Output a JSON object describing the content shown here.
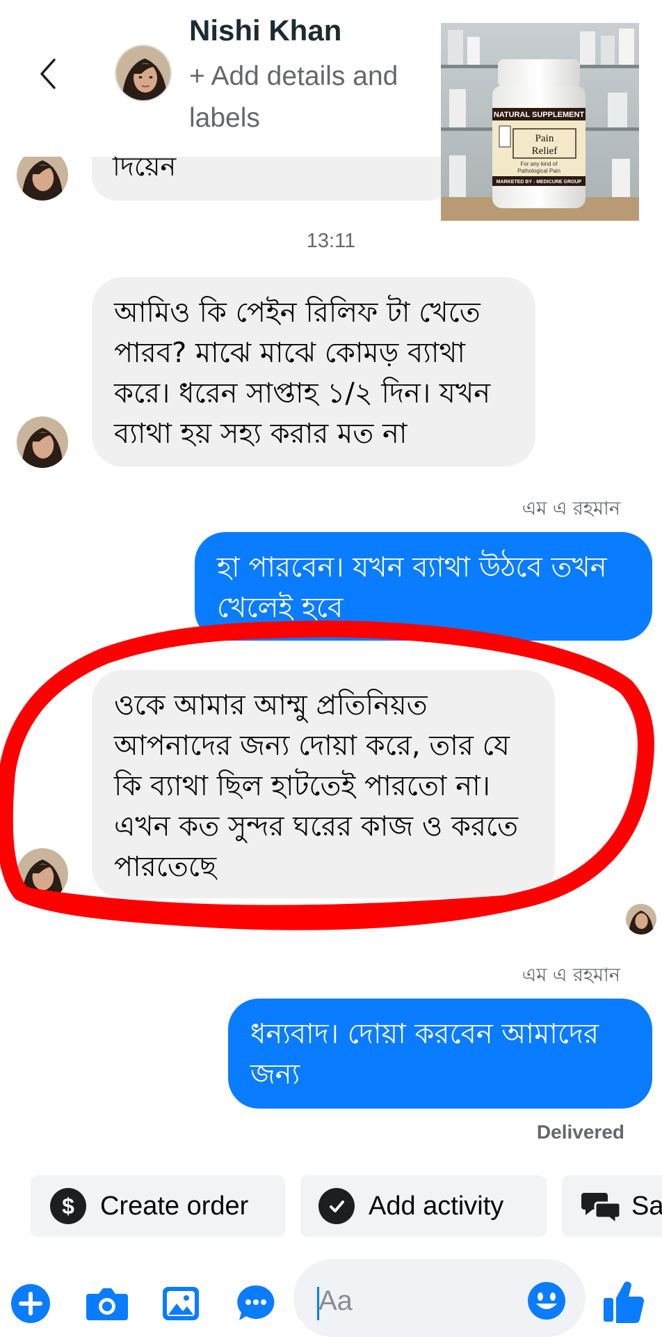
{
  "header": {
    "contact_name": "Nishi Khan",
    "subtitle": "+ Add details and labels",
    "back_icon": "chevron-left-icon"
  },
  "product_image": {
    "banner": "NATURAL SUPPLEMENT",
    "title": "Pain Relief",
    "subtitle": "For any kind of Pathological Pain",
    "footer": "MARKETED BY - MEDICURE GROUP"
  },
  "messages": [
    {
      "direction": "in",
      "text": "দিয়েন"
    },
    {
      "direction": "timestamp",
      "text": "13:11"
    },
    {
      "direction": "in",
      "text": "আমিও কি পেইন রিলিফ টা খেতে পারব? মাঝে মাঝে কোমড় ব্যাথা করে। ধরেন সাপ্তাহ ১/২ দিন। যখন ব্যাথা হয় সহ্য করার মত না"
    },
    {
      "direction": "sender",
      "text": "এম এ রহমান"
    },
    {
      "direction": "out",
      "text": "হা পারবেন। যখন ব্যাথা উঠবে তখন খেলেই হবে"
    },
    {
      "direction": "in",
      "text": "ওকে আমার আম্মু প্রতিনিয়ত আপনাদের জন্য দোয়া করে, তার যে কি ব্যাথা ছিল হাটতেই পারতো না। এখন কত সুন্দর ঘরের কাজ ও করতে পারতেছে"
    },
    {
      "direction": "sender",
      "text": "এম এ রহমান"
    },
    {
      "direction": "out",
      "text": "ধন্যবাদ। দোয়া করবেন আমাদের জন্য"
    }
  ],
  "status": {
    "delivered": "Delivered"
  },
  "quick_actions": [
    {
      "label": "Create order",
      "icon": "dollar-icon"
    },
    {
      "label": "Add activity",
      "icon": "check-circle-icon"
    },
    {
      "label": "Sa",
      "icon": "saved-replies-icon"
    }
  ],
  "composer": {
    "placeholder": "Aa",
    "icons": [
      "plus-icon",
      "camera-icon",
      "gallery-icon",
      "chat-bubble-icon",
      "emoji-icon",
      "thumbs-up-icon"
    ]
  },
  "colors": {
    "outgoing_bubble": "#0a7cff",
    "incoming_bubble": "#f0f0f0",
    "annotation": "#ff0000",
    "accent": "#0a7cff"
  }
}
